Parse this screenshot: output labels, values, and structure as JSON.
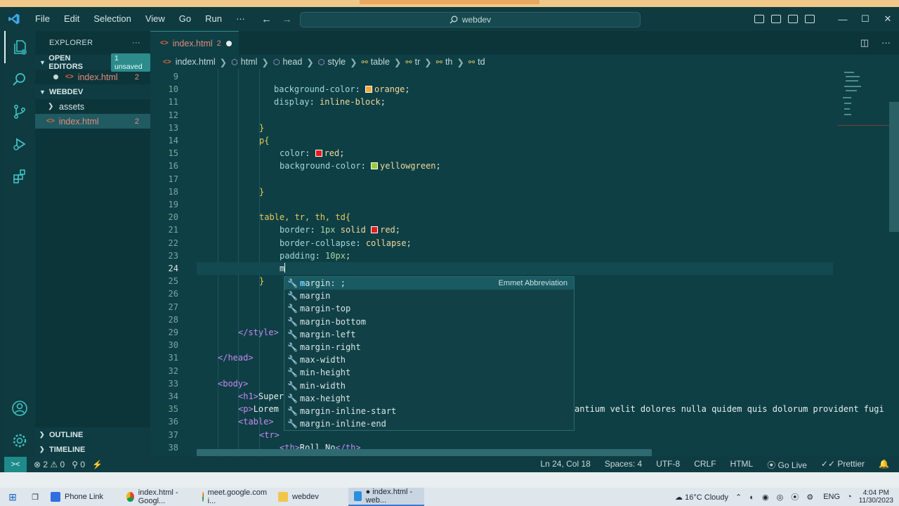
{
  "titlebar": {
    "menu": [
      "File",
      "Edit",
      "Selection",
      "View",
      "Go",
      "Run",
      "···"
    ],
    "search": "webdev",
    "back": "←",
    "forward": "→"
  },
  "sidebar": {
    "title": "EXPLORER",
    "more": "···",
    "open_editors": {
      "label": "OPEN EDITORS",
      "badge": "1 unsaved",
      "file": "index.html",
      "count": "2"
    },
    "workspace": {
      "label": "WEBDEV",
      "folder": "assets",
      "file": "index.html",
      "count": "2"
    },
    "outline": "OUTLINE",
    "timeline": "TIMELINE"
  },
  "tab": {
    "label": "index.html",
    "count": "2"
  },
  "breadcrumb": [
    "index.html",
    "html",
    "head",
    "style",
    "table",
    "tr",
    "th",
    "td"
  ],
  "editor": {
    "lines": [
      {
        "n": "9"
      },
      {
        "n": "10"
      },
      {
        "n": "11"
      },
      {
        "n": "12"
      },
      {
        "n": "13"
      },
      {
        "n": "14"
      },
      {
        "n": "15"
      },
      {
        "n": "16"
      },
      {
        "n": "17"
      },
      {
        "n": "18"
      },
      {
        "n": "19"
      },
      {
        "n": "20"
      },
      {
        "n": "21"
      },
      {
        "n": "22"
      },
      {
        "n": "23"
      },
      {
        "n": "24"
      },
      {
        "n": "25"
      },
      {
        "n": "26"
      },
      {
        "n": "27"
      },
      {
        "n": "28"
      },
      {
        "n": "29"
      },
      {
        "n": "30"
      },
      {
        "n": "31"
      },
      {
        "n": "32"
      },
      {
        "n": "33"
      },
      {
        "n": "34"
      },
      {
        "n": "35"
      },
      {
        "n": "36"
      },
      {
        "n": "37"
      },
      {
        "n": "38"
      }
    ],
    "code": {
      "l10_prop": "background-color",
      "l10_val": "orange",
      "l11_prop": "display",
      "l11_val": "inline-block",
      "l14_sel": "p",
      "l15_prop": "color",
      "l15_val": "red",
      "l16_prop": "background-color",
      "l16_val": "yellowgreen",
      "l20_sel": "table, tr, th, td",
      "l21_prop": "border",
      "l21_num": "1px",
      "l21_kw": "solid",
      "l21_val": "red",
      "l22_prop": "border-collapse",
      "l22_val": "collapse",
      "l23_prop": "padding",
      "l23_val": "10px",
      "l24_typed": "m",
      "l29": "</style>",
      "l31": "</head>",
      "l33": "<body>",
      "l34_tag": "<h1>",
      "l34_text": "Super",
      "l35_tag": "<p>",
      "l35_text": "Lorem",
      "l35_tail": "antium velit dolores nulla quidem quis dolorum provident fugi",
      "l36": "<table>",
      "l37": "<tr>",
      "l38_open": "<th>",
      "l38_text": "Roll No",
      "l38_close": "</th>"
    },
    "colors": {
      "orange": "#f4a53a",
      "red": "#e51a1a",
      "yellowgreen": "#9acd32"
    }
  },
  "suggest": {
    "detail": "Emmet Abbreviation",
    "items": [
      "margin: ;",
      "margin",
      "margin-top",
      "margin-bottom",
      "margin-left",
      "margin-right",
      "max-width",
      "min-height",
      "min-width",
      "max-height",
      "margin-inline-start",
      "margin-inline-end"
    ]
  },
  "status": {
    "problems": "2",
    "warnings": "0",
    "ports": "0",
    "position": "Ln 24, Col 18",
    "spaces": "Spaces: 4",
    "encoding": "UTF-8",
    "eol": "CRLF",
    "lang": "HTML",
    "golive": "Go Live",
    "prettier": "Prettier"
  },
  "taskbar": {
    "apps": [
      "Phone Link",
      "index.html - Googl...",
      "meet.google.com i...",
      "webdev",
      "● index.html - web..."
    ],
    "weather": "16°C Cloudy",
    "lang": "ENG",
    "time": "4:04 PM",
    "date": "11/30/2023"
  }
}
